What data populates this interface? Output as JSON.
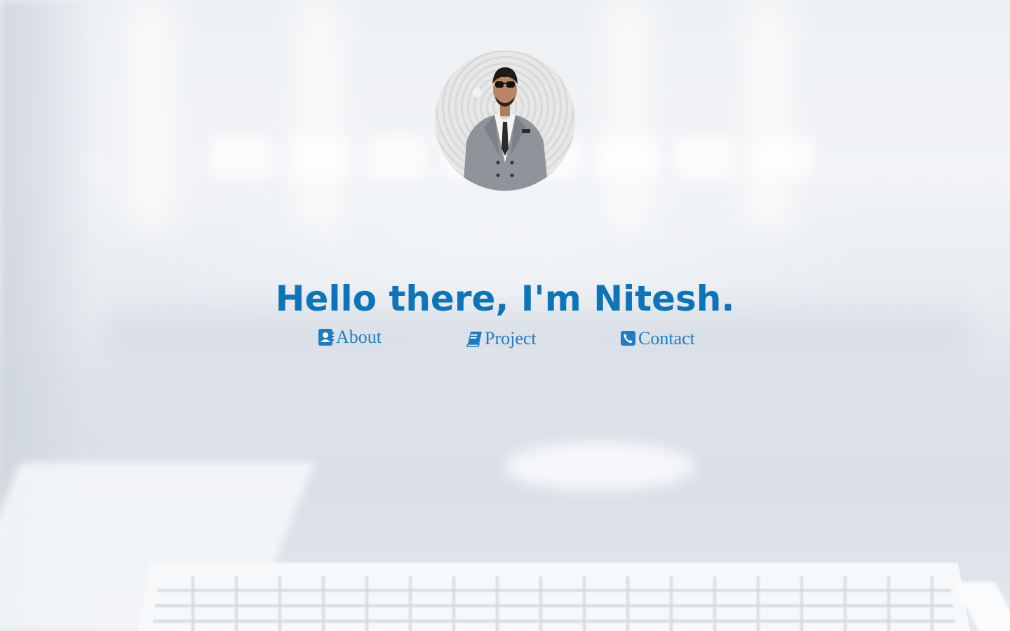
{
  "profile": {
    "greeting": "Hello there, I'm Nitesh."
  },
  "nav": {
    "about": {
      "label": "About",
      "icon": "contact-card-icon"
    },
    "project": {
      "label": "Project",
      "icon": "book-icon"
    },
    "contact": {
      "label": "Contact",
      "icon": "phone-icon"
    }
  },
  "colors": {
    "accent": "#0d74b9",
    "link": "#1f7cc0"
  }
}
